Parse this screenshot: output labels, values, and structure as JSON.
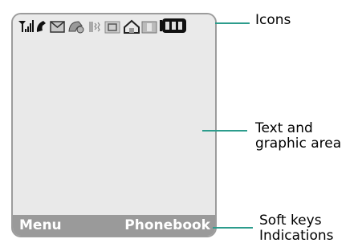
{
  "screen": {
    "icons": [
      "signal-strength-icon",
      "call-icon",
      "message-icon",
      "voicemail-icon",
      "vibrate-icon",
      "gprs-icon",
      "home-zone-icon",
      "silent-mode-icon",
      "battery-icon"
    ],
    "softkeys": {
      "left": "Menu",
      "right": "Phonebook"
    }
  },
  "callouts": {
    "icons": "Icons",
    "text_area_line1": "Text and",
    "text_area_line2": "graphic area",
    "softkeys_line1": "Soft keys",
    "softkeys_line2": "Indications"
  },
  "colors": {
    "callout_line": "#2c9c8c",
    "softkey_bar": "#9a9a9a",
    "display": "#e9e9e9"
  }
}
